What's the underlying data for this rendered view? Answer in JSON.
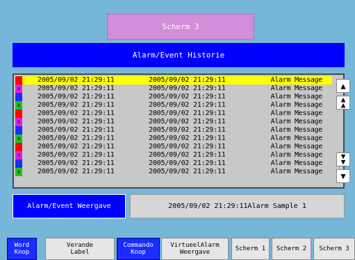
{
  "title": "Scherm 3",
  "header": "Alarm/Event Historie",
  "history": {
    "rows": [
      {
        "date1": "2005/09/02 21:29:11",
        "date2": "2005/09/02 21:29:11",
        "message": "Alarm Message",
        "color": "#ff0000",
        "mark": "",
        "selected": true
      },
      {
        "date1": "2005/09/02 21:29:11",
        "date2": "2005/09/02 21:29:11",
        "message": "Alarm Message",
        "color": "#e020e0",
        "mark": "x",
        "selected": false
      },
      {
        "date1": "2005/09/02 21:29:11",
        "date2": "2005/09/02 21:29:11",
        "message": "Alarm Message",
        "color": "#1a2cff",
        "mark": "",
        "selected": false
      },
      {
        "date1": "2005/09/02 21:29:11",
        "date2": "2005/09/02 21:29:11",
        "message": "Alarm Message",
        "color": "#20c020",
        "mark": "x",
        "selected": false
      },
      {
        "date1": "2005/09/02 21:29:11",
        "date2": "2005/09/02 21:29:11",
        "message": "Alarm Message",
        "color": "#ff0000",
        "mark": "",
        "selected": false
      },
      {
        "date1": "2005/09/02 21:29:11",
        "date2": "2005/09/02 21:29:11",
        "message": "Alarm Message",
        "color": "#e020e0",
        "mark": "x",
        "selected": false
      },
      {
        "date1": "2005/09/02 21:29:11",
        "date2": "2005/09/02 21:29:11",
        "message": "Alarm Message",
        "color": "#1a2cff",
        "mark": "",
        "selected": false
      },
      {
        "date1": "2005/09/02 21:29:11",
        "date2": "2005/09/02 21:29:11",
        "message": "Alarm Message",
        "color": "#20c020",
        "mark": "x",
        "selected": false
      },
      {
        "date1": "2005/09/02 21:29:11",
        "date2": "2005/09/02 21:29:11",
        "message": "Alarm Message",
        "color": "#ff0000",
        "mark": "",
        "selected": false
      },
      {
        "date1": "2005/09/02 21:29:11",
        "date2": "2005/09/02 21:29:11",
        "message": "Alarm Message",
        "color": "#e020e0",
        "mark": "x",
        "selected": false
      },
      {
        "date1": "2005/09/02 21:29:11",
        "date2": "2005/09/02 21:29:11",
        "message": "Alarm Message",
        "color": "#1a2cff",
        "mark": "",
        "selected": false
      },
      {
        "date1": "2005/09/02 21:29:11",
        "date2": "2005/09/02 21:29:11",
        "message": "Alarm Message",
        "color": "#20c020",
        "mark": "x",
        "selected": false
      }
    ],
    "scroll_icons": [
      "scroll-up-icon",
      "page-up-icon",
      "page-down-icon",
      "scroll-down-icon"
    ]
  },
  "status": {
    "left": "Alarm/Event Weergave",
    "right": "2005/09/02 21:29:11Alarm Sample 1"
  },
  "nav": [
    {
      "label": "Word\nKnop",
      "style": "blue"
    },
    {
      "label": "Verande\nLabel",
      "style": "gray"
    },
    {
      "label": "Commando\nKnop",
      "style": "blue"
    },
    {
      "label": "VirtueelAlarm\nWeergave",
      "style": "gray"
    },
    {
      "label": "Scherm 1",
      "style": "gray"
    },
    {
      "label": "Scherm 2",
      "style": "gray"
    },
    {
      "label": "Scherm 3",
      "style": "gray"
    }
  ],
  "colors": {
    "background": "#76b6d9",
    "accent": "#0000ff",
    "title_box": "#d28ed8",
    "selected_row": "#ffff00"
  }
}
